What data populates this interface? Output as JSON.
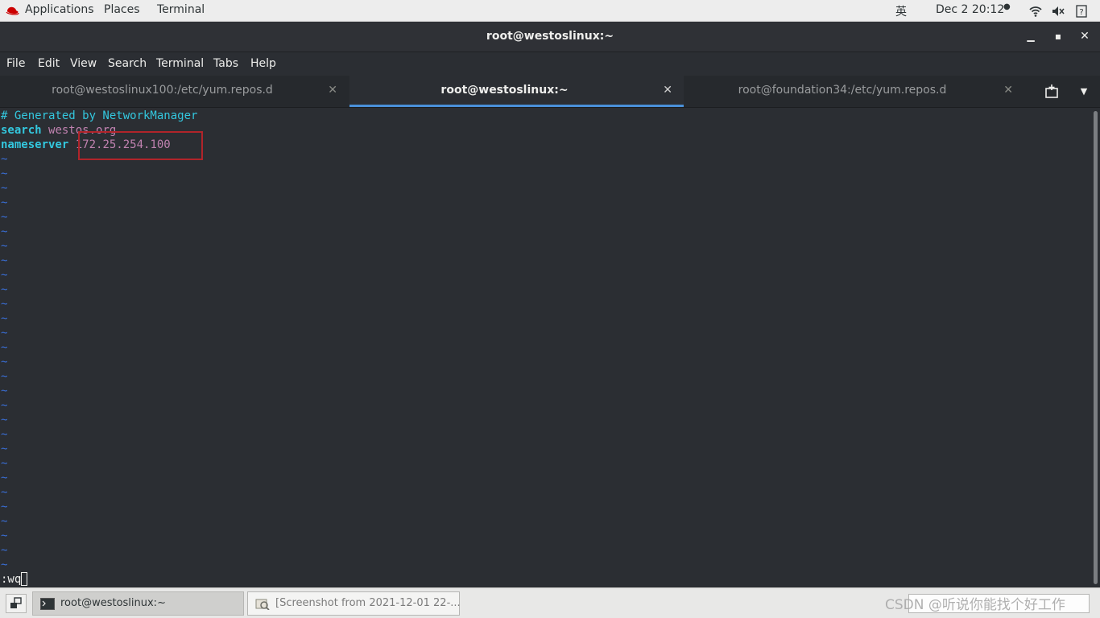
{
  "topbar": {
    "applications": "Applications",
    "places": "Places",
    "terminal": "Terminal",
    "input_method": "英",
    "datetime": "Dec 2  20:12",
    "icons": [
      "redhat-logo-icon",
      "wifi-icon",
      "volume-muted-icon",
      "help-icon"
    ]
  },
  "window": {
    "title": "root@westoslinux:~",
    "buttons": [
      "minimize-icon",
      "maximize-icon",
      "close-icon"
    ]
  },
  "menu": [
    "File",
    "Edit",
    "View",
    "Search",
    "Terminal",
    "Tabs",
    "Help"
  ],
  "tabs": [
    {
      "label": "root@westoslinux100:/etc/yum.repos.d",
      "active": false
    },
    {
      "label": "root@westoslinux:~",
      "active": true
    },
    {
      "label": "root@foundation34:/etc/yum.repos.d",
      "active": false
    }
  ],
  "editor": {
    "line1": "# Generated by NetworkManager",
    "line2_keyword": "search",
    "line2_value": "westos.org",
    "line3_keyword": "nameserver",
    "line3_value": "172.25.254.100",
    "tilde": "~",
    "tilde_count": 29,
    "command": ":wq"
  },
  "taskbar": {
    "tasks": [
      {
        "label": "root@westoslinux:~",
        "active": true
      },
      {
        "label": "[Screenshot from 2021-12-01 22-...",
        "active": false
      }
    ],
    "watermark": "CSDN @听说你能找个好工作"
  },
  "colors": {
    "terminal_bg": "#2b2e33",
    "cyan": "#33c7de",
    "magenta": "#c082b0",
    "tilde_blue": "#3a6fd8",
    "highlight_box": "#b0242a",
    "active_tab_underline": "#4a90d9"
  }
}
